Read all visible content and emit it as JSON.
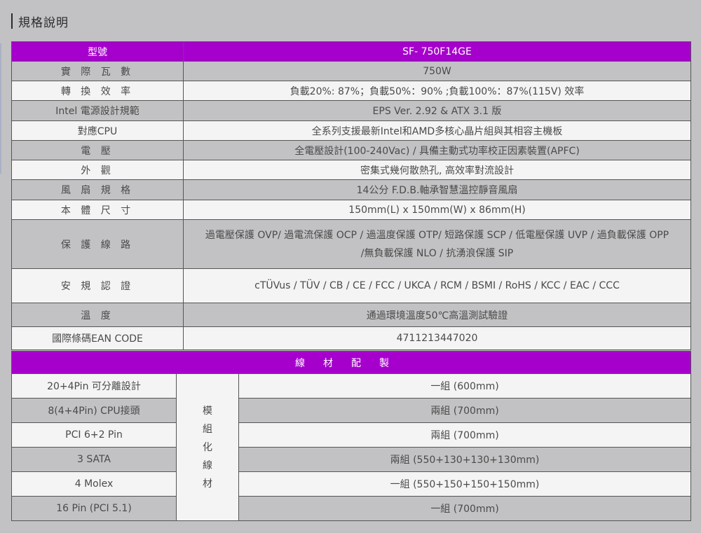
{
  "heading": "規格說明",
  "spec": {
    "header": {
      "label": "型號",
      "value": "SF- 750F14GE"
    },
    "rows": [
      {
        "label": "實 際 瓦 數",
        "value": "750W"
      },
      {
        "label": "轉 換 效 率",
        "value": "負載20%: 87%；負載50%：90% ;負載100%：87%(115V) 效率"
      },
      {
        "label": "Intel 電源設計規範",
        "value": "EPS Ver. 2.92 & ATX 3.1 版"
      },
      {
        "label": "對應CPU",
        "value": "全系列支援最新Intel和AMD多核心晶片組與其相容主機板"
      },
      {
        "label": "電 壓",
        "value": "全電壓設計(100-240Vac) / 具備主動式功率校正因素裝置(APFC)"
      },
      {
        "label": "外 觀",
        "value": "密集式幾何散熱孔, 高效率對流設計"
      },
      {
        "label": "風 扇 規 格",
        "value": "14公分 F.D.B.軸承智慧溫控靜音風扇"
      },
      {
        "label": "本 體 尺 寸",
        "value": "150mm(L) x 150mm(W) x 86mm(H)"
      },
      {
        "label": "保 護 線 路",
        "value_line1": "過電壓保護 OVP/ 過電流保護 OCP / 過溫度保護 OTP/ 短路保護 SCP / 低電壓保護 UVP / 過負載保護 OPP",
        "value_line2": "/無負載保護 NLO / 抗湧浪保護 SIP"
      },
      {
        "label": "安 規 認 證",
        "value": "cTÜVus / TÜV / CB / CE / FCC / UKCA / RCM / BSMI / RoHS / KCC / EAC / CCC"
      },
      {
        "label": "溫 度",
        "value": "通過環境溫度50℃高溫測試驗證"
      },
      {
        "label": "國際條碼EAN CODE",
        "value": "4711213447020"
      }
    ]
  },
  "cable": {
    "header": "線材配製",
    "modular_chars": [
      "模",
      "組",
      "化",
      "線",
      "材"
    ],
    "rows": [
      {
        "label": "20+4Pin 可分離設計",
        "value": "一組 (600mm)"
      },
      {
        "label": "8(4+4Pin) CPU接頭",
        "value": "兩組 (700mm)"
      },
      {
        "label": "PCI 6+2 Pin",
        "value": "兩組 (700mm)"
      },
      {
        "label": "3 SATA",
        "value": "兩組 (550+130+130+130mm)"
      },
      {
        "label": "4 Molex",
        "value": "一組 (550+150+150+150mm)"
      },
      {
        "label": "16 Pin (PCI 5.1)",
        "value": "一組 (700mm)"
      }
    ]
  }
}
